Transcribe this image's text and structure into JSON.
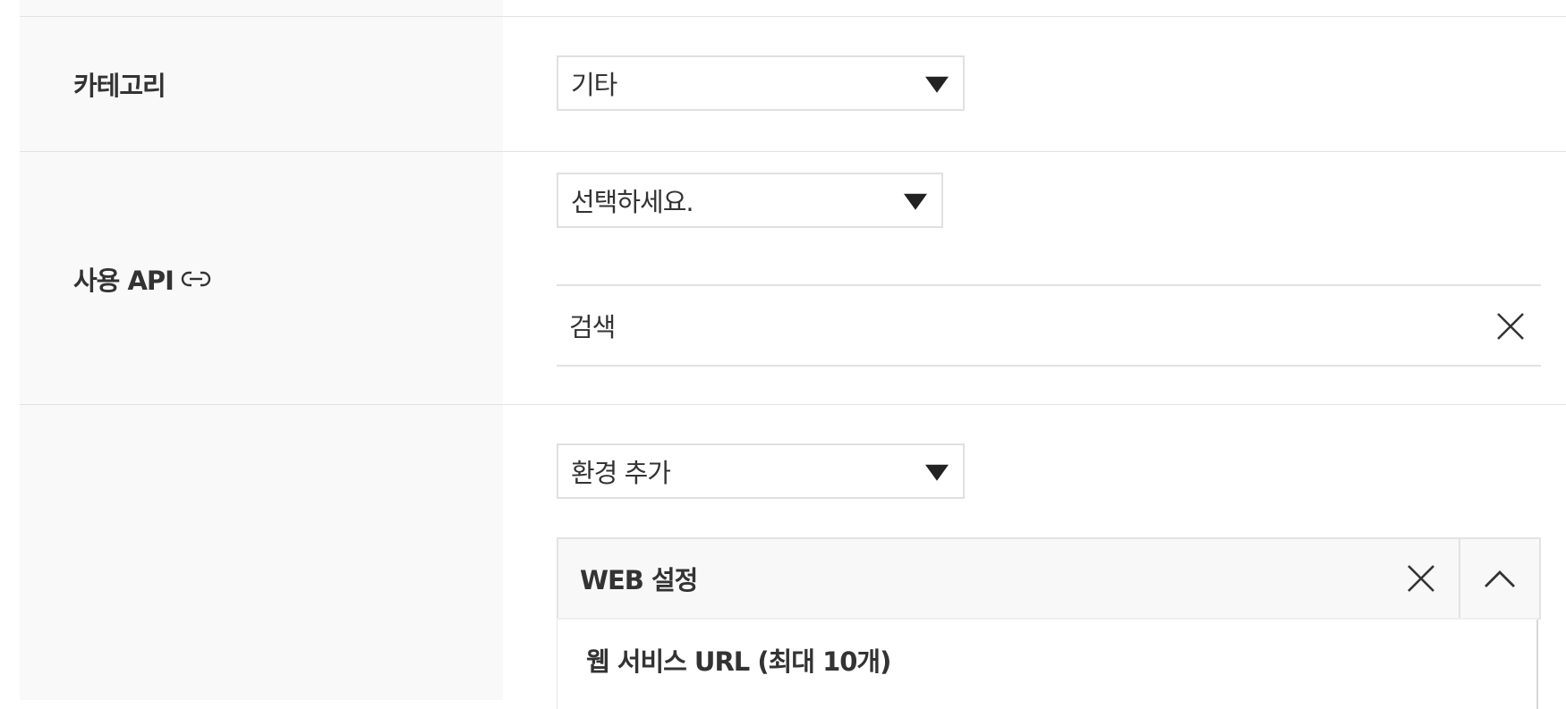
{
  "category": {
    "label": "카테고리",
    "select_value": "기타"
  },
  "api": {
    "label": "사용 API",
    "select_value": "선택하세요.",
    "search_text": "검색"
  },
  "environment": {
    "select_value": "환경 추가",
    "panel": {
      "title": "WEB 설정",
      "section_title": "웹 서비스 URL (최대 10개)"
    }
  },
  "icons": {
    "link": "link-icon",
    "clear": "close-icon",
    "dropdown": "caret-down-icon",
    "collapse": "chevron-up-icon"
  },
  "colors": {
    "label_background": "#f9f9f9",
    "border": "#e2e2e2",
    "text": "#333333"
  }
}
